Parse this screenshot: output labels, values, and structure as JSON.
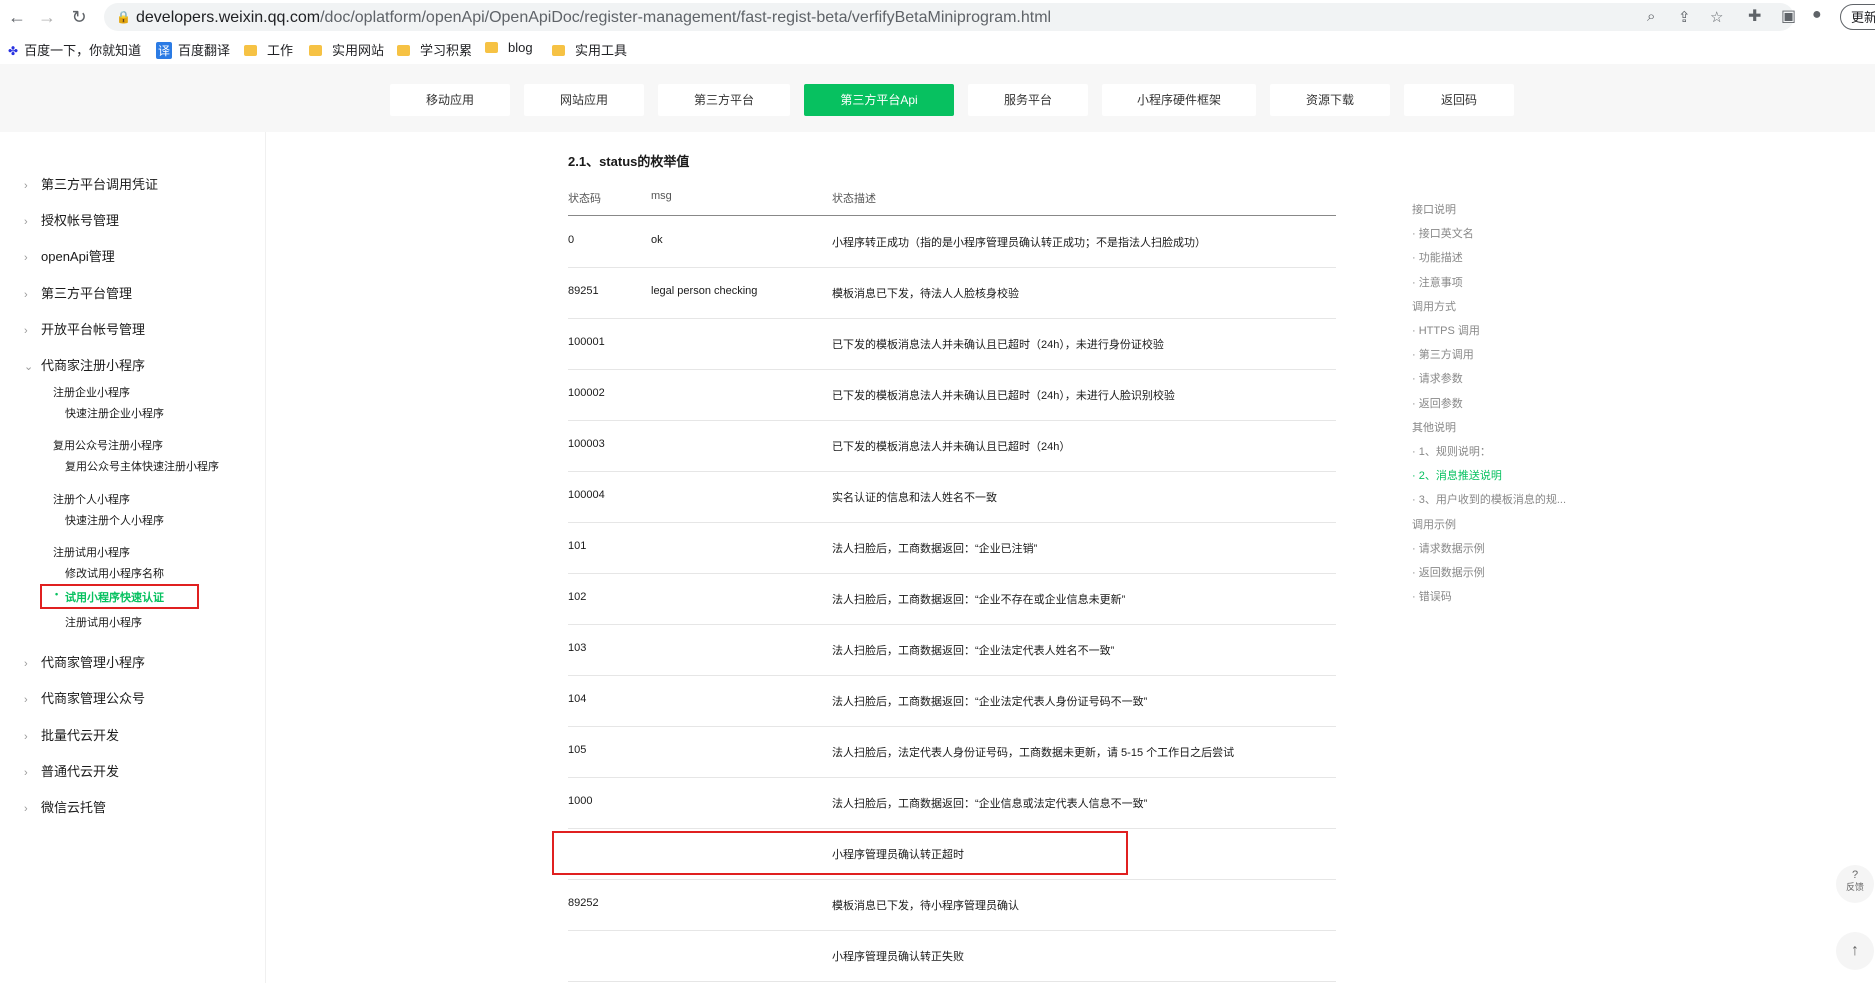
{
  "browser": {
    "url_host": "developers.weixin.qq.com",
    "url_path": "/doc/oplatform/openApi/OpenApiDoc/register-management/fast-regist-beta/verfifyBetaMiniprogram.html",
    "update_label": "更新",
    "bookmarks": [
      "百度一下，你就知道",
      "百度翻译",
      "工作",
      "实用网站",
      "学习积累",
      "blog",
      "实用工具"
    ]
  },
  "topnav": [
    "移动应用",
    "网站应用",
    "第三方平台",
    "第三方平台Api",
    "服务平台",
    "小程序硬件框架",
    "资源下载",
    "返回码"
  ],
  "sidebar": {
    "top_items": [
      "第三方平台调用凭证",
      "授权帐号管理",
      "openApi管理",
      "第三方平台管理",
      "开放平台帐号管理",
      "代商家注册小程序"
    ],
    "groups": [
      {
        "title": "注册企业小程序",
        "subs": [
          "快速注册企业小程序"
        ]
      },
      {
        "title": "复用公众号注册小程序",
        "subs": [
          "复用公众号主体快速注册小程序"
        ]
      },
      {
        "title": "注册个人小程序",
        "subs": [
          "快速注册个人小程序"
        ]
      },
      {
        "title": "注册试用小程序",
        "subs": [
          "修改试用小程序名称",
          "试用小程序快速认证",
          "注册试用小程序"
        ]
      }
    ],
    "bottom_items": [
      "代商家管理小程序",
      "代商家管理公众号",
      "批量代云开发",
      "普通代云开发",
      "微信云托管"
    ]
  },
  "main": {
    "section_title": "2.1、status的枚举值",
    "headers": [
      "状态码",
      "msg",
      "状态描述"
    ],
    "rows": [
      {
        "code": "0",
        "msg": "ok",
        "desc": "小程序转正成功（指的是小程序管理员确认转正成功；不是指法人扫脸成功）"
      },
      {
        "code": "89251",
        "msg": "legal person checking",
        "desc": "模板消息已下发，待法人人脸核身校验"
      },
      {
        "code": "100001",
        "msg": "",
        "desc": "已下发的模板消息法人并未确认且已超时（24h），未进行身份证校验"
      },
      {
        "code": "100002",
        "msg": "",
        "desc": "已下发的模板消息法人并未确认且已超时（24h），未进行人脸识别校验"
      },
      {
        "code": "100003",
        "msg": "",
        "desc": "已下发的模板消息法人并未确认且已超时（24h）"
      },
      {
        "code": "100004",
        "msg": "",
        "desc": "实名认证的信息和法人姓名不一致"
      },
      {
        "code": "101",
        "msg": "",
        "desc": "法人扫脸后，工商数据返回：“企业已注销”"
      },
      {
        "code": "102",
        "msg": "",
        "desc": "法人扫脸后，工商数据返回：“企业不存在或企业信息未更新”"
      },
      {
        "code": "103",
        "msg": "",
        "desc": "法人扫脸后，工商数据返回：“企业法定代表人姓名不一致”"
      },
      {
        "code": "104",
        "msg": "",
        "desc": "法人扫脸后，工商数据返回：“企业法定代表人身份证号码不一致”"
      },
      {
        "code": "105",
        "msg": "",
        "desc": "法人扫脸后，法定代表人身份证号码，工商数据未更新，请 5-15 个工作日之后尝试"
      },
      {
        "code": "1000",
        "msg": "",
        "desc": "法人扫脸后，工商数据返回：“企业信息或法定代表人信息不一致”"
      },
      {
        "code": "",
        "msg": "",
        "desc": "小程序管理员确认转正超时"
      },
      {
        "code": "89252",
        "msg": "",
        "desc": "模板消息已下发，待小程序管理员确认"
      },
      {
        "code": "",
        "msg": "",
        "desc": "小程序管理员确认转正失败"
      }
    ]
  },
  "toc": {
    "items": [
      {
        "label": "接口说明",
        "level": 0
      },
      {
        "label": "· 接口英文名",
        "level": 1
      },
      {
        "label": "· 功能描述",
        "level": 1
      },
      {
        "label": "· 注意事项",
        "level": 1
      },
      {
        "label": "调用方式",
        "level": 0
      },
      {
        "label": "· HTTPS 调用",
        "level": 1
      },
      {
        "label": "· 第三方调用",
        "level": 1
      },
      {
        "label": "· 请求参数",
        "level": 1
      },
      {
        "label": "· 返回参数",
        "level": 1
      },
      {
        "label": "其他说明",
        "level": 0
      },
      {
        "label": "· 1、规则说明：",
        "level": 1
      },
      {
        "label": "· 2、消息推送说明",
        "level": 1
      },
      {
        "label": "· 3、用户收到的模板消息的规...",
        "level": 1
      },
      {
        "label": "调用示例",
        "level": 0
      },
      {
        "label": "· 请求数据示例",
        "level": 1
      },
      {
        "label": "· 返回数据示例",
        "level": 1
      },
      {
        "label": "· 错误码",
        "level": 1
      }
    ]
  },
  "float": {
    "feedback": "反馈",
    "feedback_icon": "?",
    "top_icon": "↑"
  }
}
